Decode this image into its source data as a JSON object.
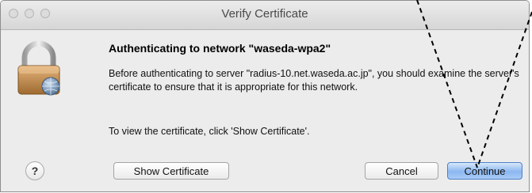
{
  "window": {
    "title": "Verify Certificate"
  },
  "dialog": {
    "heading": "Authenticating to network \"waseda-wpa2\"",
    "message": "Before authenticating to server \"radius-10.net.waseda.ac.jp\", you should examine the server's certificate to ensure that it is appropriate for this network.",
    "hint": "To view the certificate, click 'Show Certificate'."
  },
  "buttons": {
    "help": "?",
    "show_certificate": "Show Certificate",
    "cancel": "Cancel",
    "continue": "Continue"
  }
}
